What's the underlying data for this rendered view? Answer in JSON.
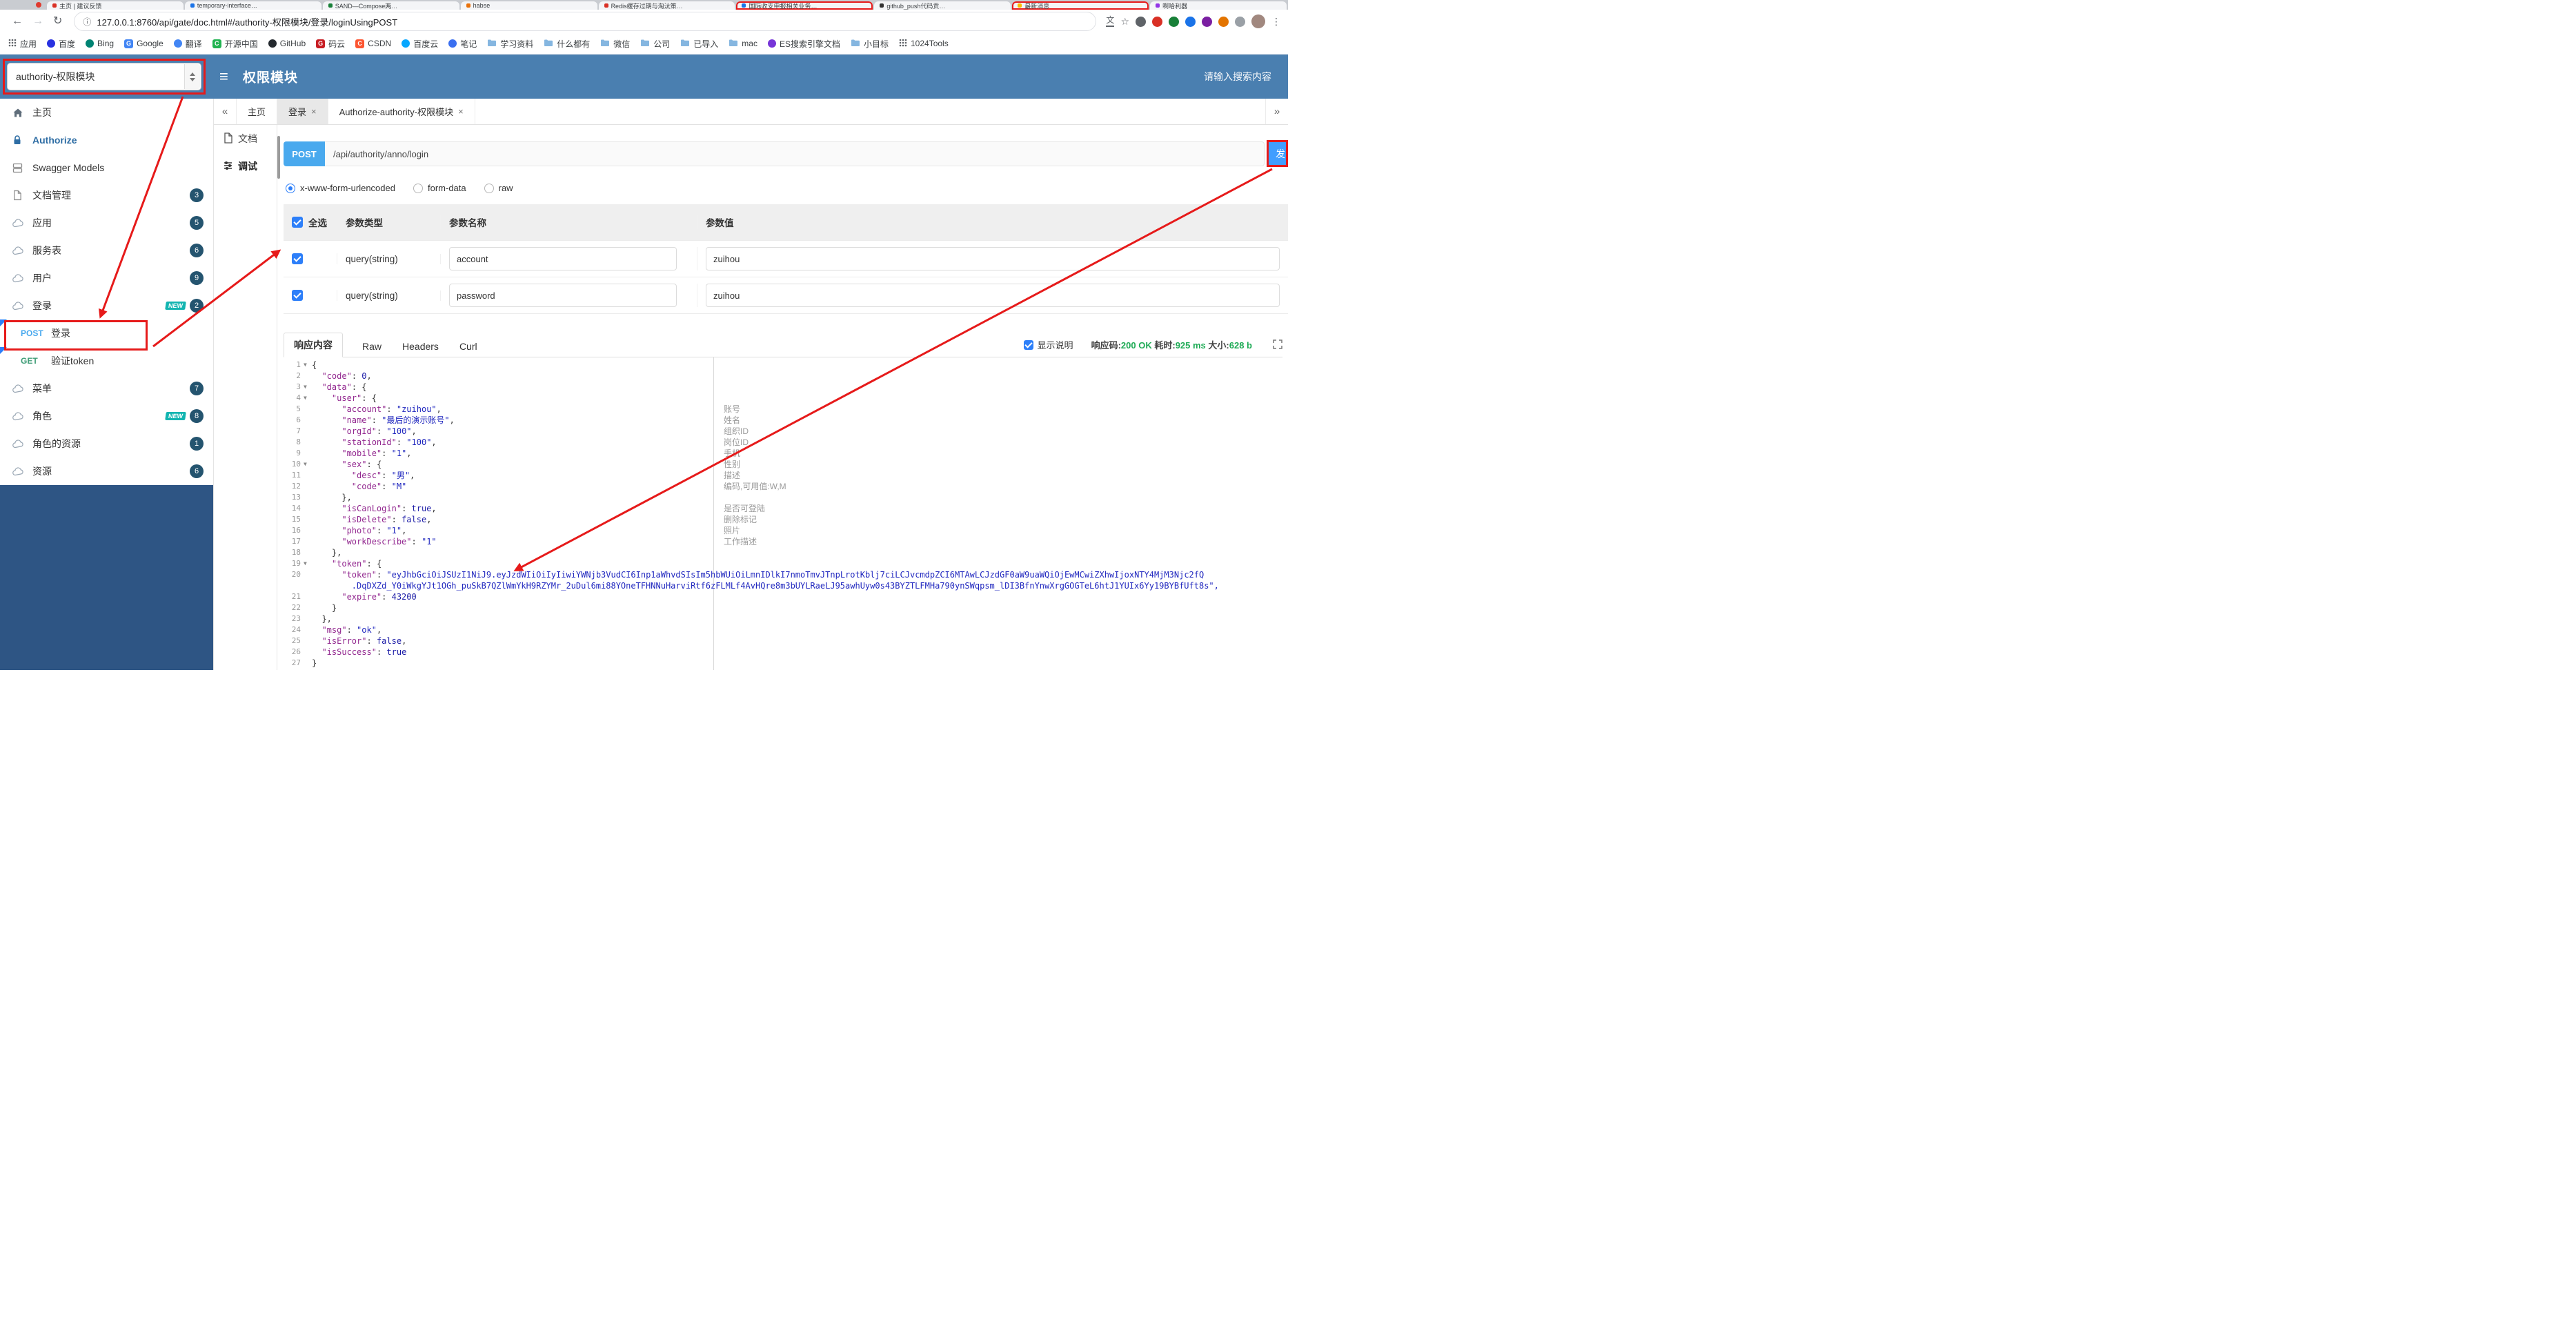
{
  "theme": {
    "header_blue": "#4a7fb0",
    "accent_blue": "#49a9ee",
    "annotation_red": "#e61a1a",
    "success_green": "#1fab56",
    "sidebar_dark": "#2e5584"
  },
  "browser": {
    "tabs": [
      {
        "title": "主页 | 建议反馈",
        "fav": "#d93025"
      },
      {
        "title": "temporary-interface…",
        "fav": "#1a73e8"
      },
      {
        "title": "SAND—Compose两…",
        "fav": "#188038"
      },
      {
        "title": "habse",
        "fav": "#e8710a"
      },
      {
        "title": "Redis缓存过期与淘汰策…",
        "fav": "#d93025"
      },
      {
        "title": "国际收支申报相关业务…",
        "fav": "#1a73e8",
        "hl": true
      },
      {
        "title": "github_push代码贡…",
        "fav": "#333333"
      },
      {
        "title": "最新消息",
        "fav": "#fbbc04",
        "hl": true
      },
      {
        "title": "啊哈利器",
        "fav": "#9334e6"
      }
    ],
    "url": "127.0.0.1:8760/api/gate/doc.html#/authority-权限模块/登录/loginUsingPOST",
    "bookmarks": [
      {
        "label": "应用",
        "kind": "apps"
      },
      {
        "label": "百度",
        "kind": "dot",
        "bg": "#2932e1"
      },
      {
        "label": "Bing",
        "kind": "dot",
        "bg": "#008373"
      },
      {
        "label": "Google",
        "kind": "letter",
        "bg": "#4285f4",
        "ch": "G"
      },
      {
        "label": "翻译",
        "kind": "dot",
        "bg": "#4285f4"
      },
      {
        "label": "开源中国",
        "kind": "letter",
        "bg": "#21b351",
        "ch": "C"
      },
      {
        "label": "GitHub",
        "kind": "dot",
        "bg": "#24292e"
      },
      {
        "label": "码云",
        "kind": "letter",
        "bg": "#c71d23",
        "ch": "G"
      },
      {
        "label": "CSDN",
        "kind": "letter",
        "bg": "#fc5531",
        "ch": "C"
      },
      {
        "label": "百度云",
        "kind": "dot",
        "bg": "#06a7ff"
      },
      {
        "label": "笔记",
        "kind": "dot",
        "bg": "#3a6ff0"
      },
      {
        "label": "学习资料",
        "kind": "folder"
      },
      {
        "label": "什么都有",
        "kind": "folder"
      },
      {
        "label": "微信",
        "kind": "folder"
      },
      {
        "label": "公司",
        "kind": "folder"
      },
      {
        "label": "已导入",
        "kind": "folder"
      },
      {
        "label": "mac",
        "kind": "folder"
      },
      {
        "label": "ES搜索引擎文档",
        "kind": "dot",
        "bg": "#7635d8"
      },
      {
        "label": "小目标",
        "kind": "folder"
      },
      {
        "label": "1024Tools",
        "kind": "apps"
      }
    ]
  },
  "header": {
    "module_select": "authority-权限模块",
    "title": "权限模块",
    "search_placeholder": "请输入搜索内容"
  },
  "sidebar": {
    "items": [
      {
        "key": "home",
        "label": "主页",
        "icon": "home"
      },
      {
        "key": "authorize",
        "label": "Authorize",
        "icon": "lock",
        "cls": "auth"
      },
      {
        "key": "swagger-models",
        "label": "Swagger Models",
        "icon": "models"
      },
      {
        "key": "doc-manage",
        "label": "文档管理",
        "icon": "doc",
        "badge": "3"
      },
      {
        "key": "app",
        "label": "应用",
        "icon": "cloud",
        "badge": "5"
      },
      {
        "key": "service",
        "label": "服务表",
        "icon": "cloud",
        "badge": "6"
      },
      {
        "key": "user",
        "label": "用户",
        "icon": "cloud",
        "badge": "9"
      },
      {
        "key": "login",
        "label": "登录",
        "icon": "cloud",
        "badge": "2",
        "new": "NEW"
      },
      {
        "key": "login-post",
        "label": "登录",
        "method": "POST",
        "active": true
      },
      {
        "key": "verify-token-get",
        "label": "验证token",
        "method": "GET"
      },
      {
        "key": "menu",
        "label": "菜单",
        "icon": "cloud",
        "badge": "7"
      },
      {
        "key": "role",
        "label": "角色",
        "icon": "cloud",
        "badge": "8",
        "new": "NEW"
      },
      {
        "key": "role-resource",
        "label": "角色的资源",
        "icon": "cloud",
        "badge": "1"
      },
      {
        "key": "resource",
        "label": "资源",
        "icon": "cloud",
        "badge": "6"
      }
    ]
  },
  "tabsbar": {
    "prev": "«",
    "next": "»",
    "close_glyph": "×",
    "items": [
      {
        "label": "主页"
      },
      {
        "label": "登录"
      },
      {
        "label": "Authorize-authority-权限模块"
      }
    ]
  },
  "docside": {
    "doc": "文档",
    "debug": "调试"
  },
  "request": {
    "method": "POST",
    "path": "/api/authority/anno/login",
    "send_label": "发",
    "types": [
      "x-www-form-urlencoded",
      "form-data",
      "raw"
    ],
    "selected_type": "x-www-form-urlencoded"
  },
  "params": {
    "headers": [
      "全选",
      "参数类型",
      "参数名称",
      "参数值"
    ],
    "rows": [
      {
        "checked": true,
        "type": "query(string)",
        "name": "account",
        "value": "zuihou"
      },
      {
        "checked": true,
        "type": "query(string)",
        "name": "password",
        "value": "zuihou"
      }
    ]
  },
  "response": {
    "tabs": [
      "响应内容",
      "Raw",
      "Headers",
      "Curl"
    ],
    "active_tab": "响应内容",
    "show_desc": "显示说明",
    "meta": [
      {
        "label": "响应码:",
        "value": "200 OK"
      },
      {
        "label": "耗时:",
        "value": "925 ms"
      },
      {
        "label": "大小:",
        "value": "628 b"
      }
    ]
  },
  "code": {
    "rows": [
      {
        "n": 1,
        "t": "{",
        "fold": true
      },
      {
        "n": 2,
        "t": "  \"code\": 0,"
      },
      {
        "n": 3,
        "t": "  \"data\": {",
        "fold": true
      },
      {
        "n": 4,
        "t": "    \"user\": {",
        "fold": true
      },
      {
        "n": 5,
        "t": "      \"account\": \"zuihou\",",
        "a": "账号"
      },
      {
        "n": 6,
        "t": "      \"name\": \"最后的演示账号\",",
        "a": "姓名"
      },
      {
        "n": 7,
        "t": "      \"orgId\": \"100\",",
        "a": "组织ID"
      },
      {
        "n": 8,
        "t": "      \"stationId\": \"100\",",
        "a": "岗位ID"
      },
      {
        "n": 9,
        "t": "      \"mobile\": \"1\",",
        "a": "手机"
      },
      {
        "n": 10,
        "t": "      \"sex\": {",
        "fold": true,
        "a": "性别"
      },
      {
        "n": 11,
        "t": "        \"desc\": \"男\",",
        "a": "描述"
      },
      {
        "n": 12,
        "t": "        \"code\": \"M\"",
        "a": "编码,可用值:W,M"
      },
      {
        "n": 13,
        "t": "      },"
      },
      {
        "n": 14,
        "t": "      \"isCanLogin\": true,",
        "a": "是否可登陆"
      },
      {
        "n": 15,
        "t": "      \"isDelete\": false,",
        "a": "删除标记"
      },
      {
        "n": 16,
        "t": "      \"photo\": \"1\",",
        "a": "照片"
      },
      {
        "n": 17,
        "t": "      \"workDescribe\": \"1\"",
        "a": "工作描述"
      },
      {
        "n": 18,
        "t": "    },"
      },
      {
        "n": 19,
        "t": "    \"token\": {",
        "fold": true
      },
      {
        "n": 20,
        "t": "      \"token\": \"eyJhbGciOiJSUzI1NiJ9.eyJzdWIiOiIyIiwiYWNjb3VudCI6Inp1aWhvdSIsIm5hbWUiOiLmnIDlkI7nmoTmvJTnpLrotKblj7ciLCJvcmdpZCI6MTAwLCJzdGF0aW9uaWQiOjEwMCwiZXhwIjoxNTY4MjM3Njc2fQ"
      },
      {
        "t": "        .DqDXZd_Y0iWkgYJt1OGh_puSkB7QZlWmYkH9RZYMr_2uDul6mi88YOneTFHNNuHarviRtf6zFLMLf4AvHQre8m3bUYLRaeLJ95awhUyw0s43BYZTLFMHa790ynSWqpsm_lDI3BfnYnwXrgGOGTeL6htJ1YUIx6Yy19BYBfUft8s\",",
        "cls": "str"
      },
      {
        "n": 21,
        "t": "      \"expire\": 43200"
      },
      {
        "n": 22,
        "t": "    }"
      },
      {
        "n": 23,
        "t": "  },"
      },
      {
        "n": 24,
        "t": "  \"msg\": \"ok\","
      },
      {
        "n": 25,
        "t": "  \"isError\": false,"
      },
      {
        "n": 26,
        "t": "  \"isSuccess\": true"
      },
      {
        "n": 27,
        "t": "}"
      }
    ]
  }
}
